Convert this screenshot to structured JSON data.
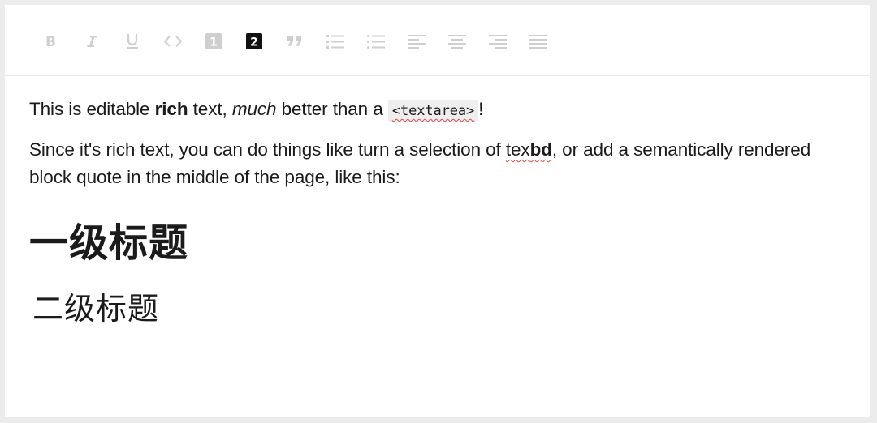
{
  "toolbar": {
    "buttons": [
      {
        "icon": "bold-icon",
        "active": false
      },
      {
        "icon": "italic-icon",
        "active": false
      },
      {
        "icon": "underline-icon",
        "active": false
      },
      {
        "icon": "code-icon",
        "active": false
      },
      {
        "icon": "heading-one-icon",
        "active": false,
        "label": "1"
      },
      {
        "icon": "heading-two-icon",
        "active": true,
        "label": "2"
      },
      {
        "icon": "block-quote-icon",
        "active": false
      },
      {
        "icon": "numbered-list-icon",
        "active": false
      },
      {
        "icon": "bulleted-list-icon",
        "active": false
      },
      {
        "icon": "align-left-icon",
        "active": false
      },
      {
        "icon": "align-center-icon",
        "active": false
      },
      {
        "icon": "align-right-icon",
        "active": false
      },
      {
        "icon": "align-justify-icon",
        "active": false
      }
    ],
    "colors": {
      "inactive": "#cfcfcf",
      "active": "#111111"
    }
  },
  "editor": {
    "p1": {
      "t1": "This is editable ",
      "bold": "rich",
      "t2": " text, ",
      "italic": "much",
      "t3": " better than a ",
      "code": "<textarea>",
      "t4": "!"
    },
    "p2": {
      "t1": "Since it's rich text, you can do things like turn a selection of ",
      "misspelled": "tex",
      "bold": "bd",
      "t2": ", or add a semantically rendered block quote in the middle of the page, like this:"
    },
    "heading1": "一级标题",
    "heading2": "二级标题"
  },
  "colors": {
    "spellcheck": "#d94a4a",
    "code_bg": "#eeeeee",
    "divider": "#e8e8e8"
  }
}
